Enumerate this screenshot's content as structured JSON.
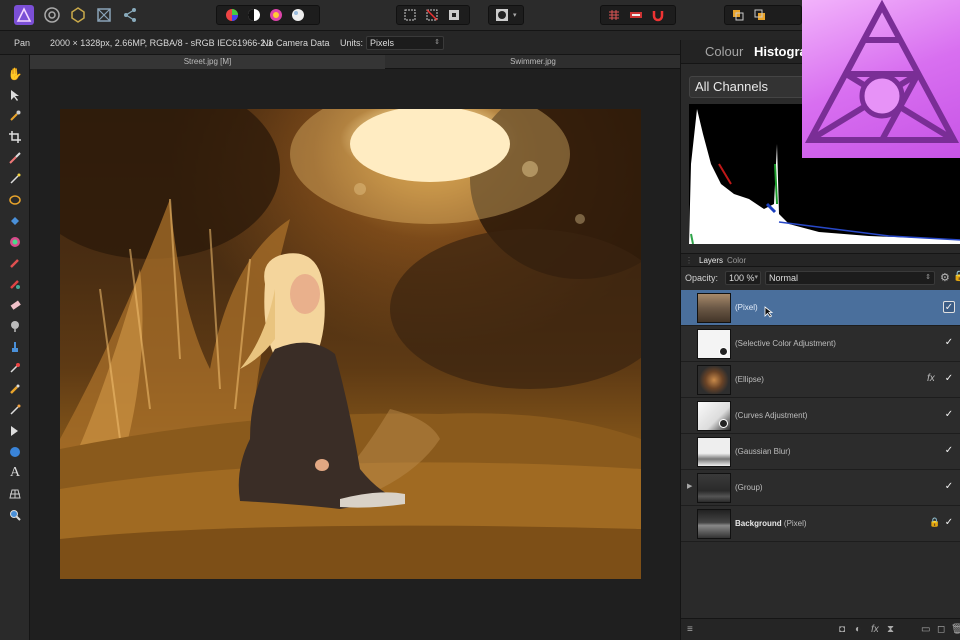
{
  "toolbar": {
    "personas": [
      "photo-persona-icon",
      "liquify-persona-icon",
      "develop-persona-icon",
      "tone-mapping-persona-icon",
      "export-persona-icon"
    ],
    "colors": {
      "accent": "#4a6f9c",
      "logo": "#d86ff0"
    }
  },
  "context": {
    "tool": "Pan",
    "doc_info": "2000 × 1328px, 2.66MP, RGBA/8 - sRGB IEC61966-2.1",
    "camera": "No Camera Data",
    "units_label": "Units:",
    "units_value": "Pixels"
  },
  "tabs": [
    {
      "label": "Street.jpg [M]"
    },
    {
      "label": "Swimmer.jpg"
    }
  ],
  "panel": {
    "tab_colour": "Colour",
    "tab_histogram": "Histogra",
    "channels": "All Channels"
  },
  "layers_panel": {
    "tab_layers": "Layers",
    "tab_color": "Color",
    "opacity_label": "Opacity:",
    "opacity_value": "100 %",
    "blend_mode": "Normal",
    "layers": [
      {
        "name": "(Pixel)",
        "check": "✓",
        "selected": true
      },
      {
        "name": "(Selective Color Adjustment)",
        "check": "✓"
      },
      {
        "name": "(Ellipse)",
        "check": "✓",
        "fx": "fx"
      },
      {
        "name": "(Curves Adjustment)",
        "check": "✓"
      },
      {
        "name": "(Gaussian Blur)",
        "check": "✓"
      },
      {
        "name": "(Group)",
        "check": "✓",
        "expander": "▶"
      },
      {
        "name_bold": "Background",
        "name_suffix": "(Pixel)",
        "check": "✓",
        "lock": "🔒"
      }
    ]
  }
}
